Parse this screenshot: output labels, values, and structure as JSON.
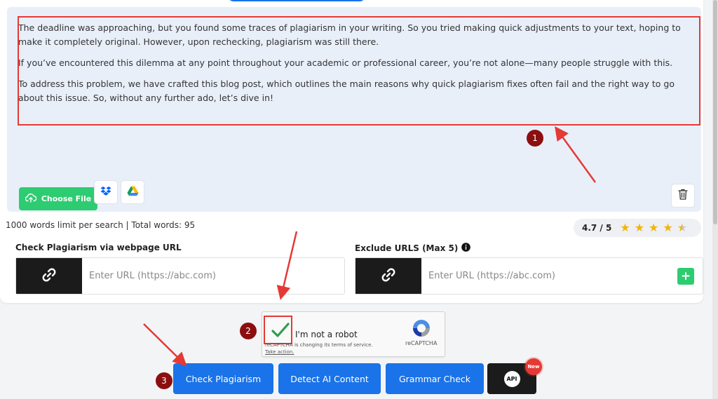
{
  "editor": {
    "paragraphs": [
      "The deadline was approaching, but you found some traces of plagiarism in your writing. So you tried making quick adjustments to your text, hoping to make it completely original. However, upon rechecking, plagiarism was still there.",
      "If you’ve encountered this dilemma at any point throughout your academic or professional career, you’re not alone—many people struggle with this.",
      "To address this problem, we have crafted this blog post, which outlines the main reasons why quick plagiarism fixes often fail and the right way to go about this issue. So, without any further ado, let’s dive in!"
    ],
    "choose_file_label": "Choose File",
    "icons": [
      "upload-cloud-icon",
      "dropbox-icon",
      "google-drive-icon",
      "trash-icon"
    ]
  },
  "stats": {
    "word_info": "1000 words limit per search | Total words: 95",
    "rating": "4.7 / 5",
    "stars_filled": 4.5
  },
  "webpage_url": {
    "label": "Check Plagiarism via webpage URL",
    "placeholder": "Enter URL (https://abc.com)"
  },
  "exclude_urls": {
    "label": "Exclude URLS (Max 5)",
    "placeholder": "Enter URL (https://abc.com)",
    "add_label": "+"
  },
  "recaptcha": {
    "label": "I'm not a robot",
    "notice": "reCAPTCHA is changing its terms of service.",
    "link": "Take action.",
    "brand": "reCAPTCHA"
  },
  "actions": {
    "check_plagiarism": "Check Plagiarism",
    "detect_ai": "Detect AI Content",
    "grammar_check": "Grammar Check",
    "api": "API",
    "new_badge": "New"
  },
  "annotations": {
    "step1": "1",
    "step2": "2",
    "step3": "3"
  },
  "colors": {
    "accent_blue": "#1a73e8",
    "accent_green": "#2ecc71",
    "annotation_red": "#e53935",
    "step_badge": "#8b0f0f",
    "star": "#f4b400"
  }
}
